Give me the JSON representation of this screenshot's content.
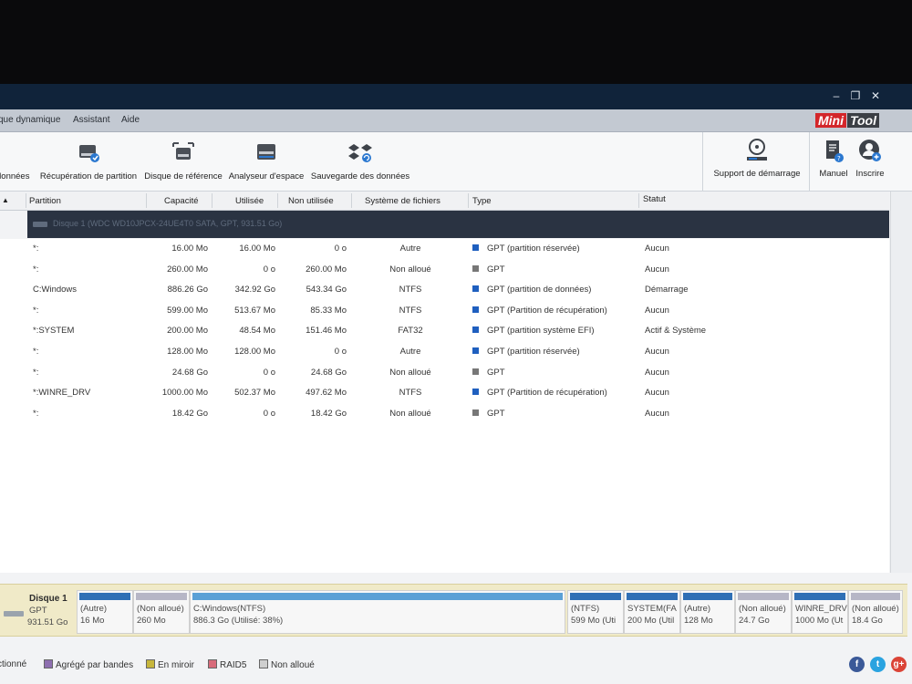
{
  "window_controls": {
    "minimize": "–",
    "restore": "❐",
    "close": "✕"
  },
  "menu": [
    "que dynamique",
    "Assistant",
    "Aide"
  ],
  "logo": {
    "mini": "Mini",
    "tool": "Tool"
  },
  "toolbar": {
    "items": [
      {
        "label": "données",
        "icon": "data-icon"
      },
      {
        "label": "Récupération de partition",
        "icon": "partition-recovery-icon"
      },
      {
        "label": "Disque de référence",
        "icon": "disk-benchmark-icon"
      },
      {
        "label": "Analyseur d'espace",
        "icon": "space-analyzer-icon"
      },
      {
        "label": "Sauvegarde des données",
        "icon": "data-backup-icon"
      }
    ],
    "right": [
      {
        "label": "Support de démarrage",
        "icon": "bootable-media-icon"
      },
      {
        "label": "Manuel",
        "icon": "manual-icon"
      },
      {
        "label": "Inscrire",
        "icon": "register-icon"
      }
    ]
  },
  "table": {
    "columns": [
      "Partition",
      "Capacité",
      "Utilisée",
      "Non utilisée",
      "Système de fichiers",
      "Type",
      "Statut"
    ],
    "disk_header": "Disque 1 (WDC WD10JPCX-24UE4T0 SATA, GPT, 931.51 Go)",
    "rows": [
      {
        "partition": "*:",
        "capacity": "16.00 Mo",
        "used": "16.00 Mo",
        "unused": "0 o",
        "fs": "Autre",
        "type": "GPT (partition réservée)",
        "status": "Aucun",
        "type_color": "#1f5fbf"
      },
      {
        "partition": "*:",
        "capacity": "260.00 Mo",
        "used": "0 o",
        "unused": "260.00 Mo",
        "fs": "Non alloué",
        "type": "GPT",
        "status": "Aucun",
        "type_color": "#777777"
      },
      {
        "partition": "C:Windows",
        "capacity": "886.26 Go",
        "used": "342.92 Go",
        "unused": "543.34 Go",
        "fs": "NTFS",
        "type": "GPT (partition de données)",
        "status": "Démarrage",
        "type_color": "#1f5fbf"
      },
      {
        "partition": "*:",
        "capacity": "599.00 Mo",
        "used": "513.67 Mo",
        "unused": "85.33 Mo",
        "fs": "NTFS",
        "type": "GPT (Partition de récupération)",
        "status": "Aucun",
        "type_color": "#1f5fbf"
      },
      {
        "partition": "*:SYSTEM",
        "capacity": "200.00 Mo",
        "used": "48.54 Mo",
        "unused": "151.46 Mo",
        "fs": "FAT32",
        "type": "GPT (partition système EFI)",
        "status": "Actif & Système",
        "type_color": "#1f5fbf"
      },
      {
        "partition": "*:",
        "capacity": "128.00 Mo",
        "used": "128.00 Mo",
        "unused": "0 o",
        "fs": "Autre",
        "type": "GPT (partition réservée)",
        "status": "Aucun",
        "type_color": "#1f5fbf"
      },
      {
        "partition": "*:",
        "capacity": "24.68 Go",
        "used": "0 o",
        "unused": "24.68 Go",
        "fs": "Non alloué",
        "type": "GPT",
        "status": "Aucun",
        "type_color": "#777777"
      },
      {
        "partition": "*:WINRE_DRV",
        "capacity": "1000.00 Mo",
        "used": "502.37 Mo",
        "unused": "497.62 Mo",
        "fs": "NTFS",
        "type": "GPT (Partition de récupération)",
        "status": "Aucun",
        "type_color": "#1f5fbf"
      },
      {
        "partition": "*:",
        "capacity": "18.42 Go",
        "used": "0 o",
        "unused": "18.42 Go",
        "fs": "Non alloué",
        "type": "GPT",
        "status": "Aucun",
        "type_color": "#777777"
      }
    ]
  },
  "disk_map": {
    "name": "Disque 1",
    "scheme": "GPT",
    "size": "931.51 Go",
    "segments": [
      {
        "l1": "(Autre)",
        "l2": "16 Mo",
        "bar": "#2f6fb5"
      },
      {
        "l1": "(Non alloué)",
        "l2": "260 Mo",
        "bar": "#b6b6c6"
      },
      {
        "l1": "C:Windows(NTFS)",
        "l2": "886.3 Go (Utilisé: 38%)",
        "bar": "#5aa0d6"
      },
      {
        "l1": "(NTFS)",
        "l2": "599 Mo (Uti",
        "bar": "#2f6fb5"
      },
      {
        "l1": "SYSTEM(FA",
        "l2": "200 Mo (Util",
        "bar": "#2f6fb5"
      },
      {
        "l1": "(Autre)",
        "l2": "128 Mo",
        "bar": "#2f6fb5"
      },
      {
        "l1": "(Non alloué)",
        "l2": "24.7 Go",
        "bar": "#b6b6c6"
      },
      {
        "l1": "WINRE_DRV",
        "l2": "1000 Mo (Ut",
        "bar": "#2f6fb5"
      },
      {
        "l1": "(Non alloué)",
        "l2": "18.4 Go",
        "bar": "#b6b6c6"
      }
    ]
  },
  "legend": [
    {
      "label": "ctionné",
      "color": ""
    },
    {
      "label": "Agrégé par bandes",
      "color": "#8e6fb0"
    },
    {
      "label": "En miroir",
      "color": "#c7b63c"
    },
    {
      "label": "RAID5",
      "color": "#d86b7a"
    },
    {
      "label": "Non alloué",
      "color": "#cfcfcf"
    }
  ],
  "social": [
    {
      "name": "facebook-icon",
      "glyph": "f",
      "color": "#3b5998"
    },
    {
      "name": "twitter-icon",
      "glyph": "t",
      "color": "#2aa3e0"
    },
    {
      "name": "googleplus-icon",
      "glyph": "g+",
      "color": "#db4437"
    }
  ]
}
